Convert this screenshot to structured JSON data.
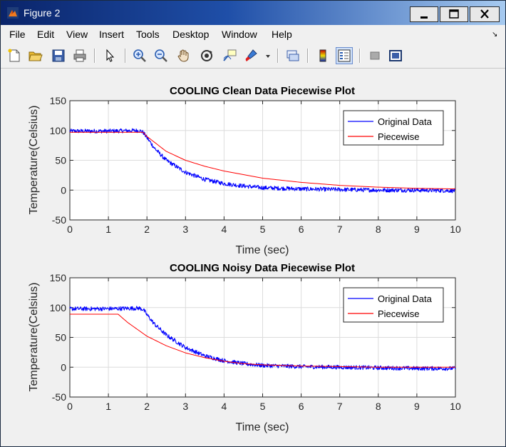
{
  "window": {
    "title": "Figure 2"
  },
  "menu": {
    "items": [
      "File",
      "Edit",
      "View",
      "Insert",
      "Tools",
      "Desktop",
      "Window",
      "Help"
    ]
  },
  "toolbar": {
    "icons": [
      "new-figure-icon",
      "open-file-icon",
      "save-icon",
      "print-icon",
      "pointer-icon",
      "zoom-in-icon",
      "zoom-out-icon",
      "pan-hand-icon",
      "rotate-3d-icon",
      "data-cursor-icon",
      "brush-icon",
      "link-plot-icon",
      "colorbar-icon",
      "legend-icon",
      "hide-plot-tools-icon",
      "show-plot-tools-icon"
    ]
  },
  "colors": {
    "original": "#0000ff",
    "piecewise": "#ff0000",
    "grid": "#dcdcdc"
  },
  "chart_data": [
    {
      "type": "line",
      "title": "COOLING Clean Data Piecewise Plot",
      "xlabel": "Time (sec)",
      "ylabel": "Temperature(Celsius)",
      "xlim": [
        0,
        10
      ],
      "ylim": [
        -50,
        150
      ],
      "xticks": [
        "0",
        "1",
        "2",
        "3",
        "4",
        "5",
        "6",
        "7",
        "8",
        "9",
        "10"
      ],
      "yticks": [
        "-50",
        "0",
        "50",
        "100",
        "150"
      ],
      "grid": true,
      "legend_position": "top-right",
      "series": [
        {
          "name": "Original Data",
          "x": [
            0,
            1,
            1.8,
            1.9,
            2.0,
            2.2,
            2.5,
            3.0,
            3.5,
            4.0,
            4.5,
            5.0,
            6.0,
            7.0,
            8.0,
            9.0,
            10.0
          ],
          "values": [
            99,
            99,
            100,
            97,
            88,
            70,
            50,
            30,
            18,
            11,
            7,
            4,
            2,
            1,
            0,
            0,
            -1
          ]
        },
        {
          "name": "Piecewise",
          "x": [
            0,
            1,
            1.9,
            2.0,
            2.5,
            3.0,
            3.5,
            4.0,
            5.0,
            6.0,
            7.0,
            8.0,
            9.0,
            10.0
          ],
          "values": [
            97,
            97,
            97,
            90,
            65,
            50,
            40,
            32,
            20,
            13,
            8,
            5,
            3,
            2
          ]
        }
      ]
    },
    {
      "type": "line",
      "title": "COOLING Noisy Data Piecewise Plot",
      "xlabel": "Time (sec)",
      "ylabel": "Temperature(Celsius)",
      "xlim": [
        0,
        10
      ],
      "ylim": [
        -50,
        150
      ],
      "xticks": [
        "0",
        "1",
        "2",
        "3",
        "4",
        "5",
        "6",
        "7",
        "8",
        "9",
        "10"
      ],
      "yticks": [
        "-50",
        "0",
        "50",
        "100",
        "150"
      ],
      "grid": true,
      "legend_position": "top-right",
      "series": [
        {
          "name": "Original Data",
          "x": [
            0,
            1,
            1.8,
            1.9,
            2.0,
            2.2,
            2.5,
            3.0,
            3.5,
            4.0,
            4.5,
            5.0,
            6.0,
            7.0,
            8.0,
            9.0,
            10.0
          ],
          "values": [
            98,
            98,
            99,
            97,
            88,
            72,
            54,
            33,
            19,
            11,
            6,
            3,
            1,
            0,
            -1,
            -2,
            -2
          ]
        },
        {
          "name": "Piecewise",
          "x": [
            0,
            1.0,
            1.25,
            1.5,
            2.0,
            2.5,
            3.0,
            3.5,
            4.0,
            4.5,
            5.0,
            6.0,
            7.0,
            8.0,
            9.0,
            10.0
          ],
          "values": [
            89,
            89,
            89,
            75,
            52,
            36,
            24,
            16,
            10,
            6,
            4,
            2,
            1,
            0,
            0,
            0
          ]
        }
      ]
    }
  ]
}
